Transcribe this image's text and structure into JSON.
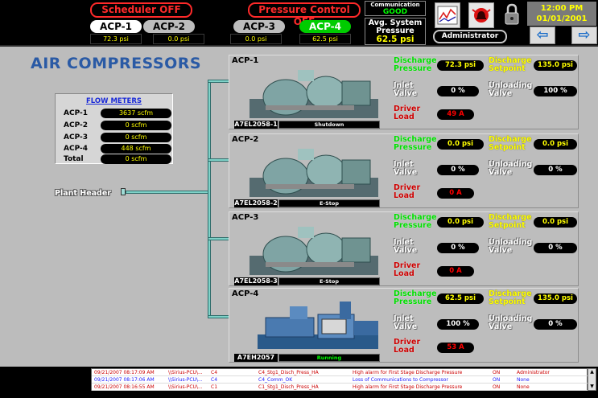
{
  "header": {
    "scheduler": "Scheduler OFF",
    "pressure_control": "Pressure Control OFF",
    "communication_label": "Communication",
    "communication_status": "GOOD",
    "avg_label": "Avg. System Pressure",
    "avg_value": "62.5 psi",
    "user": "Administrator",
    "time": "12:00 PM",
    "date": "01/01/2001"
  },
  "tabs": [
    {
      "label": "ACP-1",
      "value": "72.3 psi",
      "state": "active"
    },
    {
      "label": "ACP-2",
      "value": "0.0 psi",
      "state": "normal"
    },
    {
      "label": "ACP-3",
      "value": "0.0 psi",
      "state": "normal"
    },
    {
      "label": "ACP-4",
      "value": "62.5 psi",
      "state": "running"
    }
  ],
  "page_title": "AIR COMPRESSORS",
  "flow_meters": {
    "title": "FLOW METERS",
    "rows": [
      {
        "name": "ACP-1",
        "value": "3637 scfm"
      },
      {
        "name": "ACP-2",
        "value": "0 scfm"
      },
      {
        "name": "ACP-3",
        "value": "0 scfm"
      },
      {
        "name": "ACP-4",
        "value": "448 scfm"
      },
      {
        "name": "Total",
        "value": "0 scfm"
      }
    ]
  },
  "plant_header": "Plant Header",
  "labels": {
    "discharge_pressure": "Discharge Pressure",
    "discharge_setpoint": "Discharge Setpoint",
    "inlet_valve": "Inlet Valve",
    "unloading_valve": "Unloading Valve",
    "driver_load": "Driver Load"
  },
  "compressors": [
    {
      "name": "ACP-1",
      "model": "A7EL2058-1",
      "status": "Shutdown",
      "discharge_pressure": "72.3 psi",
      "discharge_setpoint": "135.0 psi",
      "inlet_valve": "0 %",
      "unloading_valve": "100 %",
      "driver_load": "49 A"
    },
    {
      "name": "ACP-2",
      "model": "A7EL2058-2",
      "status": "E-Stop",
      "discharge_pressure": "0.0 psi",
      "discharge_setpoint": "0.0 psi",
      "inlet_valve": "0 %",
      "unloading_valve": "0 %",
      "driver_load": "0 A"
    },
    {
      "name": "ACP-3",
      "model": "A7EL2058-3",
      "status": "E-Stop",
      "discharge_pressure": "0.0 psi",
      "discharge_setpoint": "0.0 psi",
      "inlet_valve": "0 %",
      "unloading_valve": "0 %",
      "driver_load": "0 A"
    },
    {
      "name": "ACP-4",
      "model": "A7EH2057",
      "status": "Running",
      "discharge_pressure": "62.5 psi",
      "discharge_setpoint": "135.0 psi",
      "inlet_valve": "100 %",
      "unloading_valve": "0 %",
      "driver_load": "53 A"
    }
  ],
  "alarms": [
    {
      "time": "09/21/2007 08:17:09 AM",
      "source": "\\\\Sirius-PCU\\...",
      "unit": "C4",
      "tag": "C4_Stg1_Disch_Press_HA",
      "message": "High alarm for First Stage Discharge Pressure",
      "state": "ON",
      "ack": "Administrator",
      "color": "red"
    },
    {
      "time": "09/21/2007 08:17:06 AM",
      "source": "\\\\Sirius-PCU\\...",
      "unit": "C4",
      "tag": "C4_Comm_OK",
      "message": "Loss of Communications to Compressor",
      "state": "ON",
      "ack": "None",
      "color": "blue"
    },
    {
      "time": "09/21/2007 08:16:55 AM",
      "source": "\\\\Sirius-PCU\\...",
      "unit": "C1",
      "tag": "C1_Stg1_Disch_Press_HA",
      "message": "High alarm for First Stage Discharge Pressure",
      "state": "ON",
      "ack": "None",
      "color": "red"
    }
  ]
}
